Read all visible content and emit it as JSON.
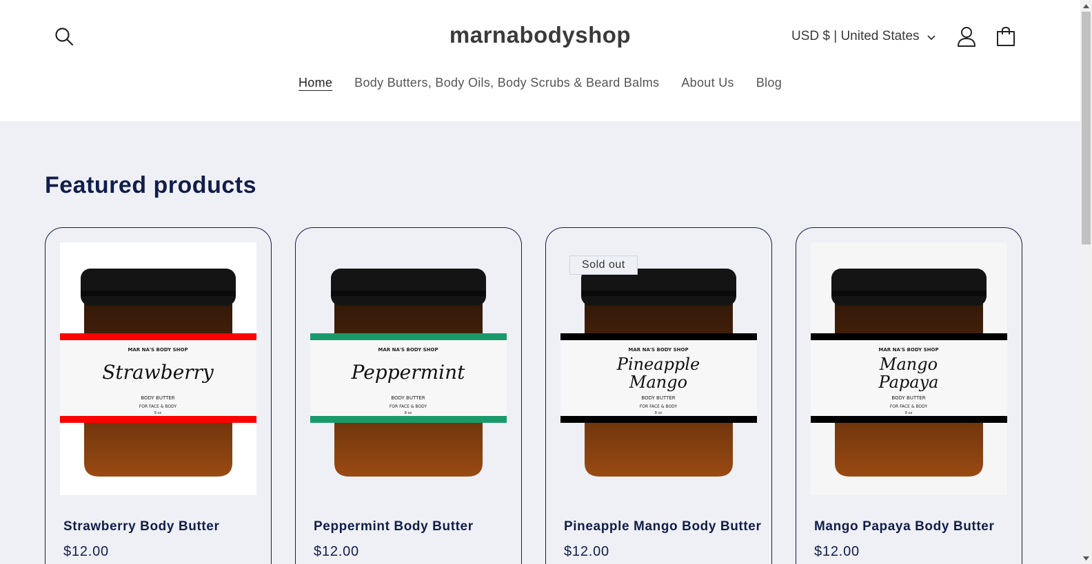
{
  "header": {
    "logo": "marnabodyshop",
    "currency": "USD $ | United States",
    "nav": [
      "Home",
      "Body Butters, Body Oils, Body Scrubs & Beard Balms",
      "About Us",
      "Blog"
    ]
  },
  "main": {
    "section_title": "Featured products",
    "products": [
      {
        "title": "Strawberry Body Butter",
        "price": "$12.00",
        "label_name": "Strawberry",
        "band_color": "#ff0000",
        "badge": ""
      },
      {
        "title": "Peppermint Body Butter",
        "price": "$12.00",
        "label_name": "Peppermint",
        "band_color": "#1a9a6a",
        "badge": ""
      },
      {
        "title": "Pineapple Mango Body Butter",
        "price": "$12.00",
        "label_name": "Pineapple Mango",
        "band_color": "#000000",
        "badge": "Sold out"
      },
      {
        "title": "Mango Papaya Body Butter",
        "price": "$12.00",
        "label_name": "Mango Papaya",
        "band_color": "#000000",
        "badge": ""
      }
    ],
    "jar_label": {
      "brand": "MAR NA'S BODY SHOP",
      "product_type": "BODY BUTTER",
      "usage": "FOR FACE & BODY",
      "size": "8 oz"
    }
  },
  "colors": {
    "accent": "#121d4a",
    "section_bg": "#eef0f5"
  }
}
